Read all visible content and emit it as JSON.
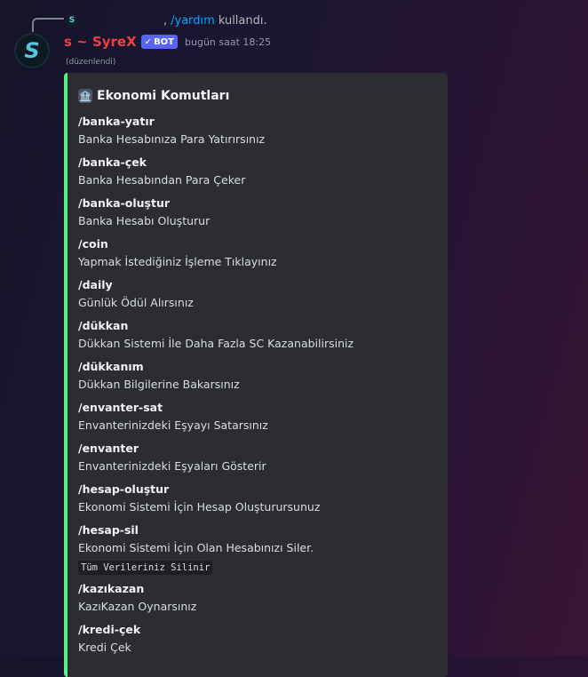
{
  "reply": {
    "mini_avatar_letter": "S",
    "comma": ",",
    "command": "/yardım",
    "used_text": "kullandı."
  },
  "author": {
    "avatar_letter": "S",
    "name": "s ~ SyreX",
    "badge_check": "✓",
    "badge": "BOT",
    "timestamp": "bugün saat 18:25",
    "edited": "(düzenlendi)"
  },
  "embed": {
    "accent_color": "#57f287",
    "title_icon": "🏦",
    "title": "Ekonomi Komutları",
    "fields": [
      {
        "name": "/banka-yatır",
        "value": "Banka Hesabınıza Para Yatırırsınız"
      },
      {
        "name": "/banka-çek",
        "value": "Banka Hesabından Para Çeker"
      },
      {
        "name": "/banka-oluştur",
        "value": "Banka Hesabı Oluşturur"
      },
      {
        "name": "/coin",
        "value": "Yapmak İstediğiniz İşleme Tıklayınız"
      },
      {
        "name": "/daily",
        "value": "Günlük Ödül Alırsınız"
      },
      {
        "name": "/dükkan",
        "value": "Dükkan Sistemi İle Daha Fazla SC Kazanabilirsiniz"
      },
      {
        "name": "/dükkanım",
        "value": "Dükkan Bilgilerine Bakarsınız"
      },
      {
        "name": "/envanter-sat",
        "value": "Envanterinizdeki Eşyayı Satarsınız"
      },
      {
        "name": "/envanter",
        "value": "Envanterinizdeki Eşyaları Gösterir"
      },
      {
        "name": "/hesap-oluştur",
        "value": "Ekonomi Sistemi İçin Hesap Oluşturursunuz"
      },
      {
        "name": "/hesap-sil",
        "value": "Ekonomi Sistemi İçin Olan Hesabınızı Siler.",
        "code": "Tüm Verileriniz Silinir"
      },
      {
        "name": "/kazıkazan",
        "value": "KazıKazan Oynarsınız"
      },
      {
        "name": "/kredi-çek",
        "value": "Kredi Çek"
      }
    ]
  }
}
